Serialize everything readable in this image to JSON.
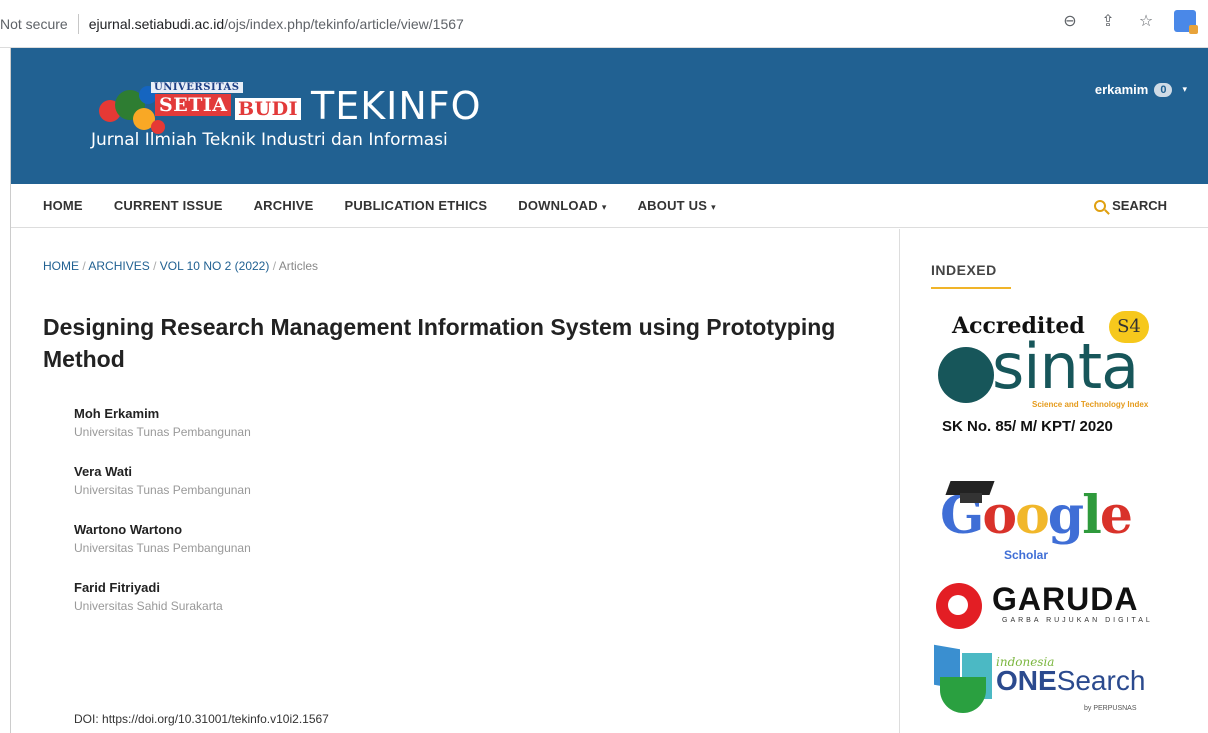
{
  "browser": {
    "security_label": "Not secure",
    "url_host": "ejurnal.setiabudi.ac.id",
    "url_path": "/ojs/index.php/tekinfo/article/view/1567"
  },
  "header": {
    "logo_univ": "UNIVERSITAS",
    "logo_setia": "SETIA",
    "logo_budi": "BUDI",
    "logo_title": "TEKINFO",
    "logo_subtitle": "Jurnal Ilmiah Teknik Industri dan Informasi",
    "username": "erkamim",
    "notification_count": "0"
  },
  "nav": {
    "items": [
      {
        "label": "HOME",
        "has_dropdown": false
      },
      {
        "label": "CURRENT ISSUE",
        "has_dropdown": false
      },
      {
        "label": "ARCHIVE",
        "has_dropdown": false
      },
      {
        "label": "PUBLICATION ETHICS",
        "has_dropdown": false
      },
      {
        "label": "DOWNLOAD",
        "has_dropdown": true
      },
      {
        "label": "ABOUT US",
        "has_dropdown": true
      }
    ],
    "search_label": "SEARCH"
  },
  "breadcrumb": {
    "home": "HOME",
    "archives": "ARCHIVES",
    "issue": "VOL 10 NO 2 (2022)",
    "section": "Articles",
    "separator": "/"
  },
  "article": {
    "title": "Designing Research Management Information System using Prototyping Method",
    "authors": [
      {
        "name": "Moh Erkamim",
        "affiliation": "Universitas Tunas Pembangunan"
      },
      {
        "name": "Vera Wati",
        "affiliation": "Universitas Tunas Pembangunan"
      },
      {
        "name": "Wartono Wartono",
        "affiliation": "Universitas Tunas Pembangunan"
      },
      {
        "name": "Farid Fitriyadi",
        "affiliation": "Universitas Sahid Surakarta"
      }
    ],
    "doi_label": "DOI:",
    "doi_url": "https://doi.org/10.31001/tekinfo.v10i2.1567"
  },
  "sidebar": {
    "heading": "INDEXED",
    "sinta": {
      "accredited": "Accredited",
      "grade": "S4",
      "word": "sinta",
      "tagline": "Science and Technology Index",
      "sk": "SK No. 85/ M/ KPT/ 2020"
    },
    "google_scholar": {
      "g1": "G",
      "o1": "o",
      "o2": "o",
      "g2": "g",
      "l": "l",
      "e": "e",
      "scholar": "Scholar"
    },
    "garuda": {
      "word": "GARUDA",
      "tagline": "GARBA RUJUKAN DIGITAL"
    },
    "onesearch": {
      "indonesia": "indonesia",
      "one": "ONE",
      "search": "Search",
      "by": "by PERPUSNAS"
    }
  }
}
